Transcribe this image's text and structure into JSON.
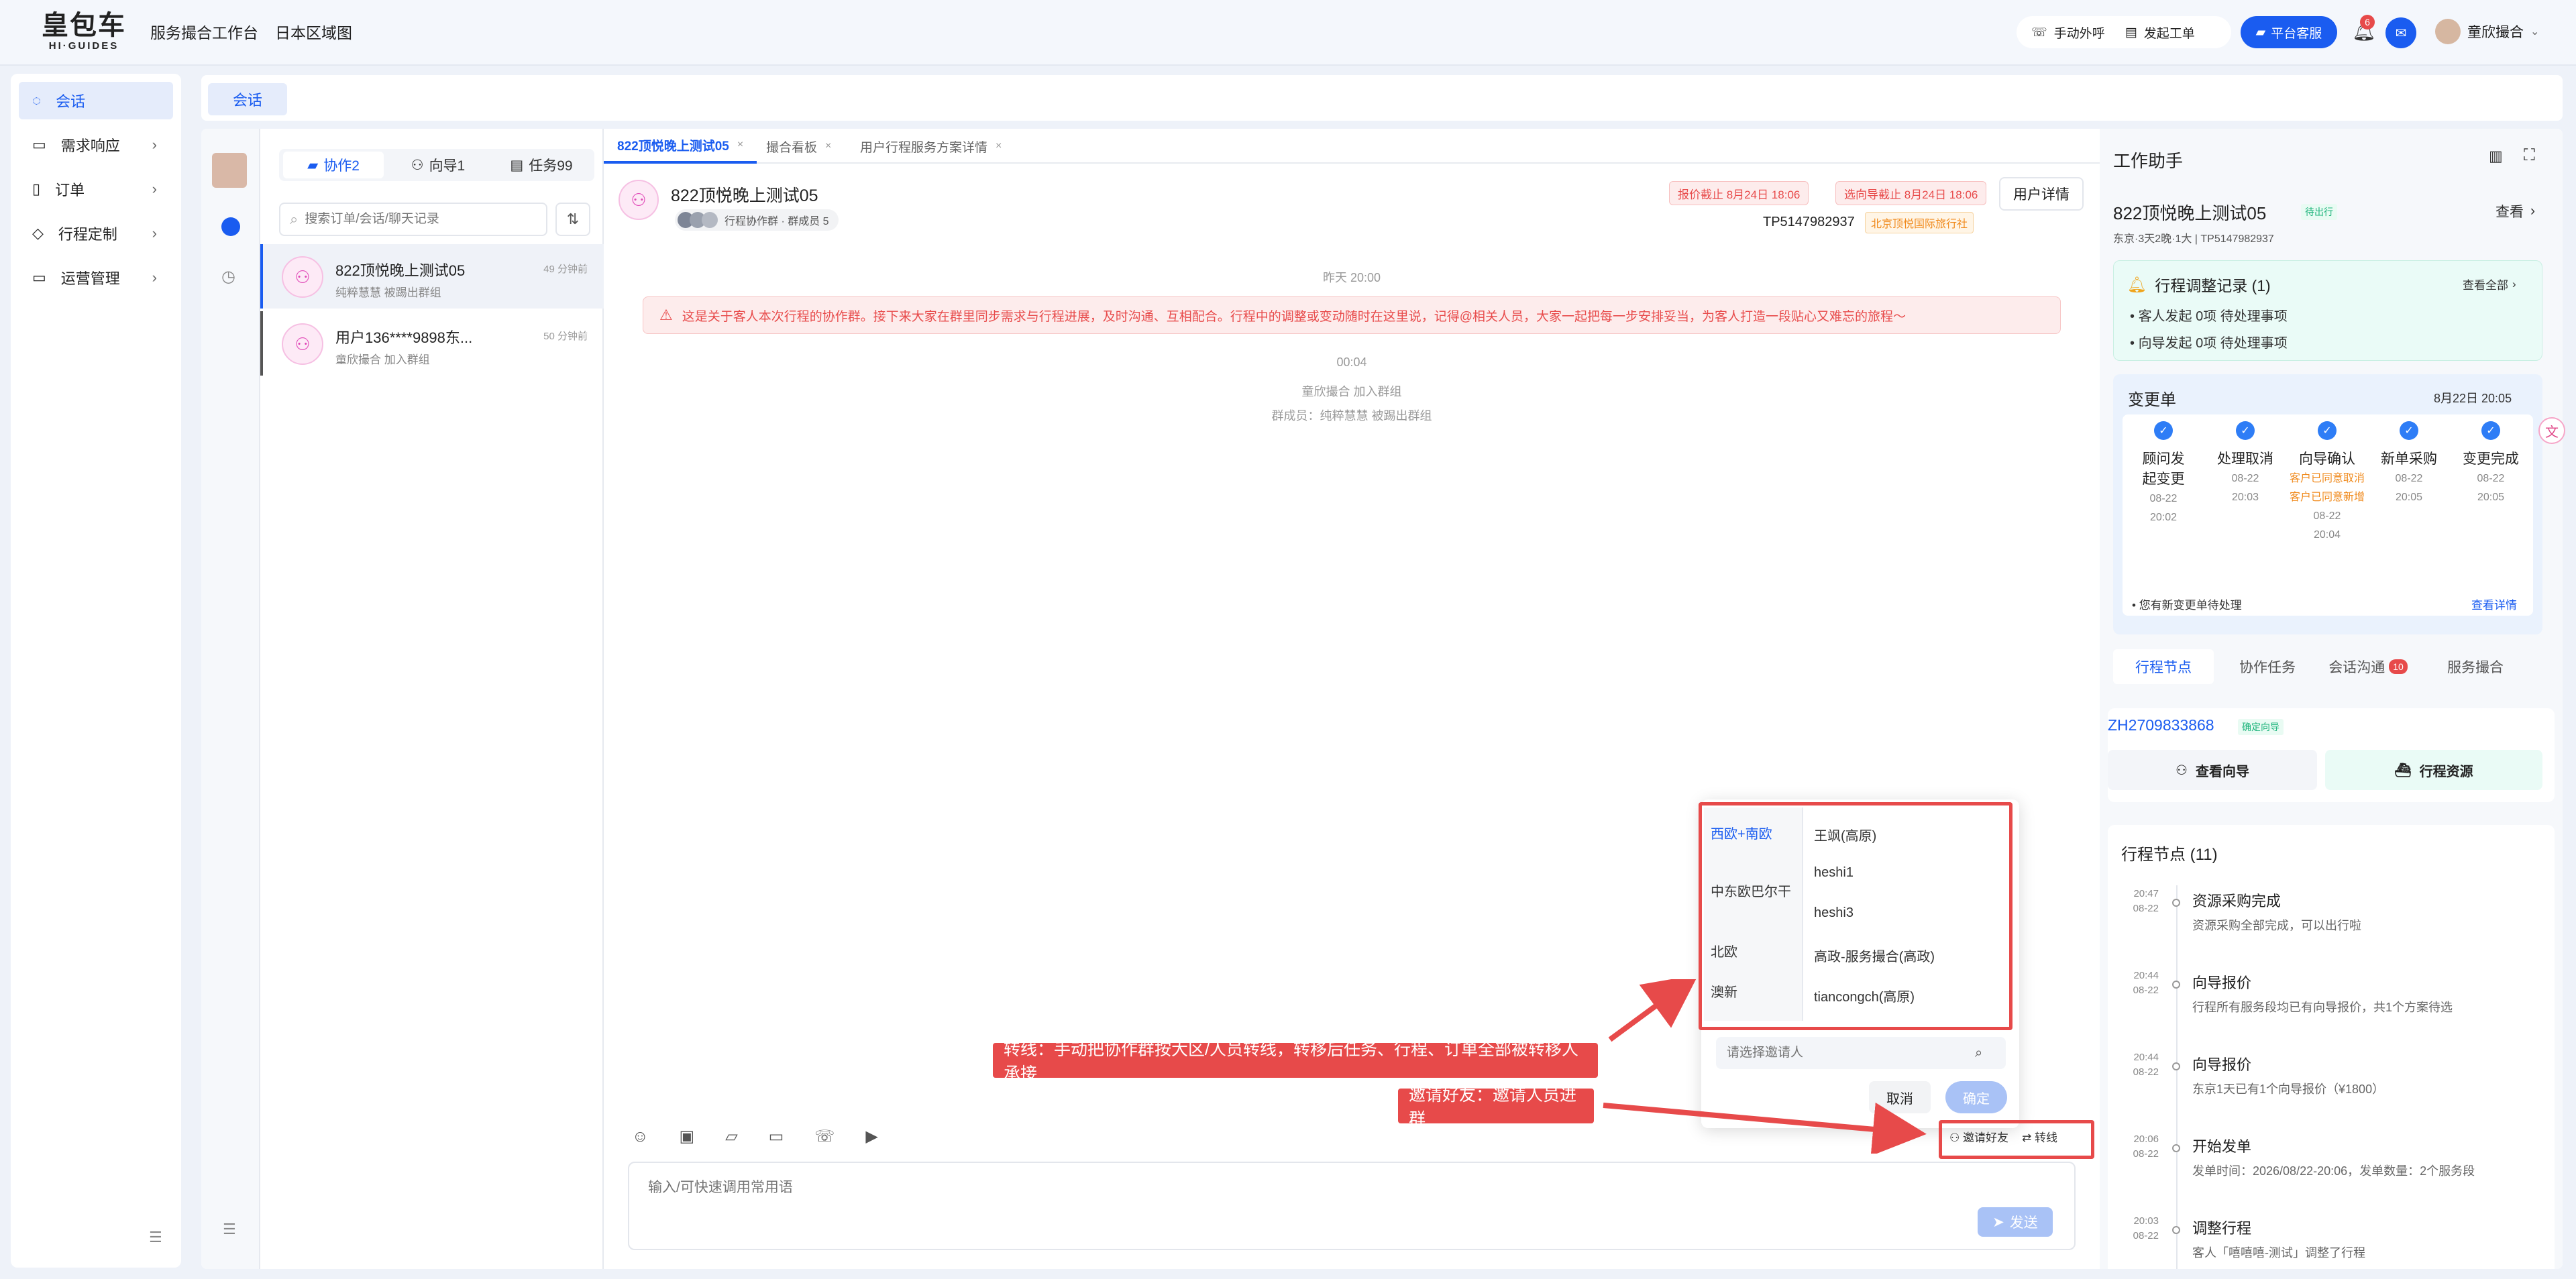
{
  "topbar": {
    "logo_cn": "皇包车",
    "logo_en": "HI·GUIDES",
    "nav": [
      "服务撮合工作台",
      "日本区域图"
    ],
    "manual_call": "手动外呼",
    "create_ticket": "发起工单",
    "platform_service": "平台客服",
    "notif_count": "6",
    "username": "童欣撮合"
  },
  "leftmenu": {
    "items": [
      {
        "label": "会话",
        "icon": "chat-icon"
      },
      {
        "label": "需求响应",
        "icon": "inbox-icon"
      },
      {
        "label": "订单",
        "icon": "order-icon"
      },
      {
        "label": "行程定制",
        "icon": "compass-icon"
      },
      {
        "label": "运营管理",
        "icon": "monitor-icon"
      }
    ]
  },
  "header_tab": "会话",
  "sessions": {
    "seg_cooperate": "协作2",
    "seg_guide": "向导1",
    "seg_task": "任务99",
    "search_placeholder": "搜索订单/会话/聊天记录",
    "items": [
      {
        "name": "822顶悦晚上测试05",
        "sub": "纯粹慧慧 被踢出群组",
        "time": "49 分钟前"
      },
      {
        "name": "用户136****9898东...",
        "sub": "童欣撮合 加入群组",
        "time": "50 分钟前"
      }
    ]
  },
  "chat": {
    "tabs": [
      "822顶悦晚上测试05",
      "撮合看板",
      "用户行程服务方案详情"
    ],
    "title": "822顶悦晚上测试05",
    "group_meta": "行程协作群 · 群成员 5",
    "quote_deadline": "报价截止 8月24日 18:06",
    "guide_deadline": "选向导截止 8月24日 18:06",
    "user_detail": "用户详情",
    "tp_no": "TP5147982937",
    "agency": "北京顶悦国际旅行社",
    "time1": "昨天 20:00",
    "notice": "这是关于客人本次行程的协作群。接下来大家在群里同步需求与行程进展，及时沟通、互相配合。行程中的调整或变动随时在这里说，记得@相关人员，大家一起把每一步安排妥当，为客人打造一段贴心又难忘的旅程～",
    "time2": "00:04",
    "sys1": "童欣撮合 加入群组",
    "sys2": "群成员：纯粹慧慧 被踢出群组",
    "input_placeholder": "输入/可快速调用常用语",
    "send": "发送",
    "invite": "邀请好友",
    "transfer": "转线"
  },
  "popup": {
    "regions": [
      "西欧+南欧",
      "中东欧巴尔干",
      "北欧",
      "澳新"
    ],
    "people": [
      "王飒(高原)",
      "heshi1",
      "heshi3",
      "高政-服务撮合(高政)",
      "tiancongch(高原)"
    ],
    "search_placeholder": "请选择邀请人",
    "cancel": "取消",
    "confirm": "确定"
  },
  "annotations": {
    "transfer_note": "转线：手动把协作群按大区/人员转线，转移后任务、行程、订单全部被转移人承接",
    "invite_note": "邀请好友：邀请人员进群"
  },
  "right": {
    "title": "工作助手",
    "trip_name": "822顶悦晚上测试05",
    "trip_status": "待出行",
    "view": "查看",
    "trip_meta": "东京·3天2晚·1大 | TP5147982937",
    "adjust_title": "行程调整记录 (1)",
    "view_all": "查看全部",
    "adjust_client": "客人发起 0项 待处理事项",
    "adjust_guide": "向导发起 0项 待处理事项",
    "change_title": "变更单",
    "change_date": "8月22日 20:05",
    "steps": [
      {
        "label": "顾问发起变更",
        "time": "08-22 20:02"
      },
      {
        "label": "处理取消",
        "time": "08-22 20:03"
      },
      {
        "label": "向导确认",
        "notes": [
          "客户已同意取消",
          "客户已同意新增"
        ],
        "time": "08-22 20:04"
      },
      {
        "label": "新单采购",
        "time": "08-22 20:05"
      },
      {
        "label": "变更完成",
        "time": "08-22 20:05"
      }
    ],
    "pending_change": "您有新变更单待处理",
    "view_detail": "查看详情",
    "tabs": [
      "行程节点",
      "协作任务",
      "会话沟通",
      "服务撮合"
    ],
    "tab_badge": "10",
    "zh_no": "ZH2709833868",
    "zh_tag": "确定向导",
    "view_guide": "查看向导",
    "trip_resource": "行程资源",
    "nodes_title": "行程节点 (11)",
    "nodes": [
      {
        "time": "20:47",
        "date": "08-22",
        "title": "资源采购完成",
        "desc": "资源采购全部完成，可以出行啦"
      },
      {
        "time": "20:44",
        "date": "08-22",
        "title": "向导报价",
        "desc": "行程所有服务段均已有向导报价，共1个方案待选"
      },
      {
        "time": "20:44",
        "date": "08-22",
        "title": "向导报价",
        "desc": "东京1天已有1个向导报价（¥1800）"
      },
      {
        "time": "20:06",
        "date": "08-22",
        "title": "开始发单",
        "desc": "发单时间：2026/08/22-20:06，发单数量：2个服务段"
      },
      {
        "time": "20:03",
        "date": "08-22",
        "title": "调整行程",
        "desc": "客人「嘻嘻嘻-测试」调整了行程"
      }
    ]
  },
  "colors": {
    "accent": "#1a5cf0",
    "alert": "#e74a4a",
    "warning": "#f08a1c"
  }
}
